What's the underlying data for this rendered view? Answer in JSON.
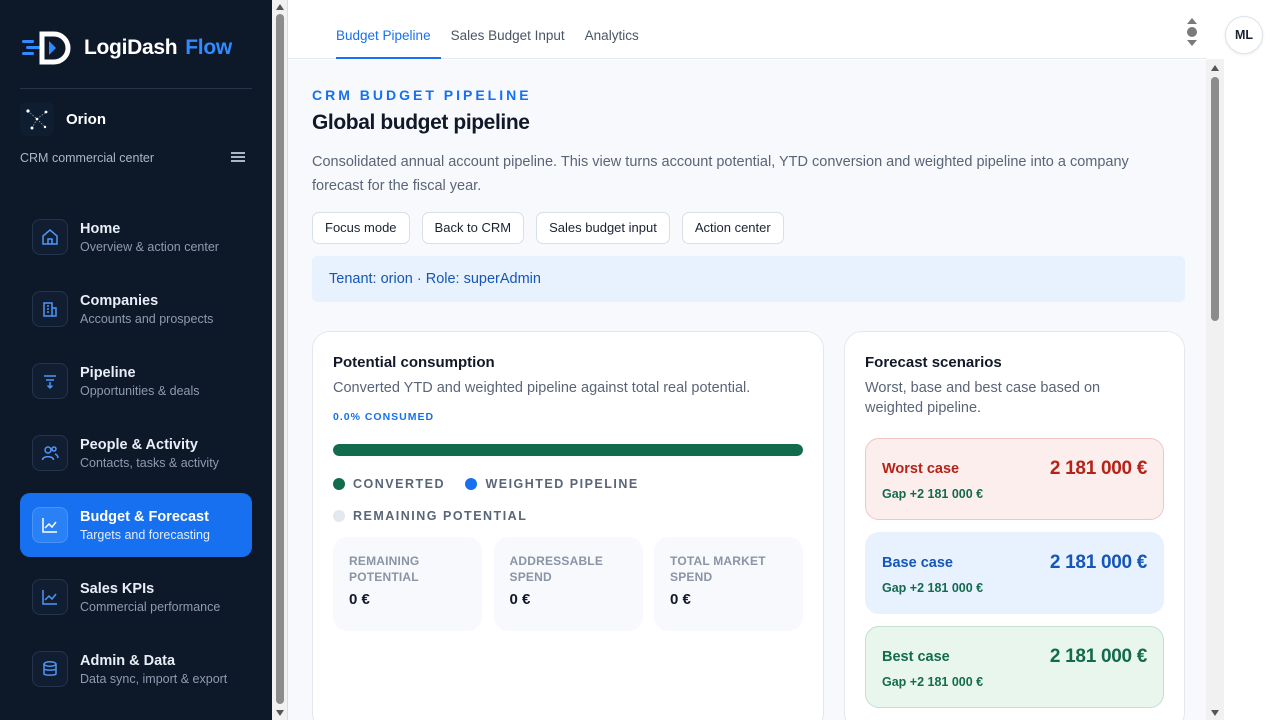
{
  "brand": {
    "name": "LogiDash",
    "suffix": "Flow"
  },
  "tenant": {
    "name": "Orion",
    "subtitle": "CRM commercial center"
  },
  "sidebar": {
    "items": [
      {
        "label": "Home",
        "sub": "Overview & action center",
        "icon": "home-icon"
      },
      {
        "label": "Companies",
        "sub": "Accounts and prospects",
        "icon": "building-icon"
      },
      {
        "label": "Pipeline",
        "sub": "Opportunities & deals",
        "icon": "funnel-icon"
      },
      {
        "label": "People & Activity",
        "sub": "Contacts, tasks & activity",
        "icon": "people-icon"
      },
      {
        "label": "Budget & Forecast",
        "sub": "Targets and forecasting",
        "icon": "chart-line-icon",
        "active": true
      },
      {
        "label": "Sales KPIs",
        "sub": "Commercial performance",
        "icon": "chart-line-icon"
      },
      {
        "label": "Admin & Data",
        "sub": "Data sync, import & export",
        "icon": "database-icon"
      }
    ]
  },
  "tabs": [
    {
      "label": "Budget Pipeline",
      "active": true
    },
    {
      "label": "Sales Budget Input"
    },
    {
      "label": "Analytics"
    }
  ],
  "user": {
    "initials": "ML"
  },
  "page": {
    "eyebrow": "CRM BUDGET PIPELINE",
    "title": "Global budget pipeline",
    "description": "Consolidated annual account pipeline. This view turns account potential, YTD conversion and weighted pipeline into a company forecast for the fiscal year.",
    "actions": [
      "Focus mode",
      "Back to CRM",
      "Sales budget input",
      "Action center"
    ],
    "tenant_banner": "Tenant: orion · Role: superAdmin"
  },
  "consumption": {
    "title": "Potential consumption",
    "subtitle": "Converted YTD and weighted pipeline against total real potential.",
    "consumed_label": "0.0% CONSUMED",
    "progress_fill_fraction": 1.0,
    "legend": [
      {
        "label": "CONVERTED",
        "color": "#136b4e"
      },
      {
        "label": "WEIGHTED PIPELINE",
        "color": "#1670f0"
      },
      {
        "label": "REMAINING POTENTIAL",
        "color": "#e3e8ef"
      }
    ],
    "stats": [
      {
        "label": "REMAINING POTENTIAL",
        "value": "0 €"
      },
      {
        "label": "ADDRESSABLE SPEND",
        "value": "0 €"
      },
      {
        "label": "TOTAL MARKET SPEND",
        "value": "0 €"
      }
    ]
  },
  "forecast": {
    "title": "Forecast scenarios",
    "subtitle": "Worst, base and best case based on weighted pipeline.",
    "scenarios": [
      {
        "name": "Worst case",
        "value": "2 181 000 €",
        "gap": "Gap +2 181 000 €"
      },
      {
        "name": "Base case",
        "value": "2 181 000 €",
        "gap": "Gap +2 181 000 €"
      },
      {
        "name": "Best case",
        "value": "2 181 000 €",
        "gap": "Gap +2 181 000 €"
      }
    ]
  }
}
